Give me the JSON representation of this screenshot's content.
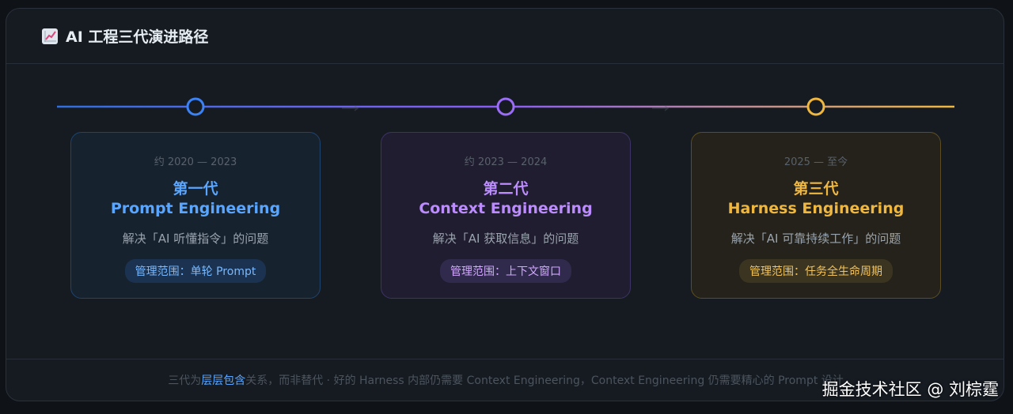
{
  "header": {
    "title": "AI 工程三代演进路径",
    "icon": "chart-increasing-icon"
  },
  "colors": {
    "gen1": "#58a6ff",
    "gen2": "#bc8cff",
    "gen3": "#f0b73e"
  },
  "generations": [
    {
      "period": "约 2020 — 2023",
      "gen": "第一代",
      "name": "Prompt Engineering",
      "problem": "解决「AI 听懂指令」的问题",
      "scope": "管理范围：单轮 Prompt"
    },
    {
      "period": "约 2023 — 2024",
      "gen": "第二代",
      "name": "Context Engineering",
      "problem": "解决「AI 获取信息」的问题",
      "scope": "管理范围：上下文窗口"
    },
    {
      "period": "2025 — 至今",
      "gen": "第三代",
      "name": "Harness Engineering",
      "problem": "解决「AI 可靠持续工作」的问题",
      "scope": "管理范围：任务全生命周期"
    }
  ],
  "footer": {
    "prefix": "三代为",
    "highlight": "层层包含",
    "suffix": "关系，而非替代 · 好的 Harness 内部仍需要 Context Engineering，Context Engineering 仍需要精心的 Prompt 设计"
  },
  "watermark": "掘金技术社区 @ 刘棕霆"
}
